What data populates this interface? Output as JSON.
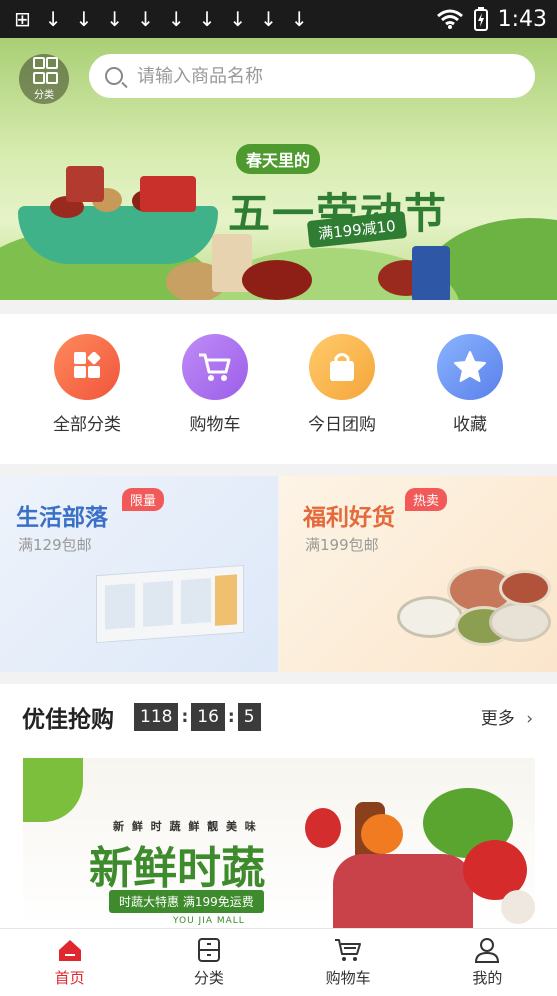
{
  "status_bar": {
    "time": "1:43"
  },
  "header": {
    "category_label": "分类",
    "search_placeholder": "请输入商品名称"
  },
  "banner": {
    "subtitle": "春天里的",
    "title": "五一劳动节",
    "promo": "满199减10"
  },
  "quick_nav": [
    {
      "label": "全部分类",
      "icon": "grid-icon",
      "color": "#f6664a"
    },
    {
      "label": "购物车",
      "icon": "cart-icon",
      "color": "#a56ef0"
    },
    {
      "label": "今日团购",
      "icon": "bag-icon",
      "color": "#f7b54a"
    },
    {
      "label": "收藏",
      "icon": "star-icon",
      "color": "#5f8ff0"
    }
  ],
  "promo_cards": [
    {
      "title": "生活部落",
      "badge": "限量",
      "subtitle": "满129包邮",
      "title_color": "#3a70c8"
    },
    {
      "title": "福利好货",
      "badge": "热卖",
      "subtitle": "满199包邮",
      "title_color": "#e4693b"
    }
  ],
  "flash_sale": {
    "title": "优佳抢购",
    "timer": {
      "hours": "118",
      "minutes": "16",
      "seconds": "5"
    },
    "more_label": "更多",
    "banner": {
      "tagline": "新 鲜 时 蔬 鲜 靓 美 味",
      "title": "新鲜时蔬",
      "promo": "时蔬大特惠 满199免运费",
      "brand": "YOU JIA MALL"
    }
  },
  "tab_bar": [
    {
      "label": "首页",
      "icon": "home-icon",
      "active": true
    },
    {
      "label": "分类",
      "icon": "category-icon",
      "active": false
    },
    {
      "label": "购物车",
      "icon": "cart-icon",
      "active": false
    },
    {
      "label": "我的",
      "icon": "user-icon",
      "active": false
    }
  ],
  "colors": {
    "accent": "#e0272e",
    "timer_bg": "#3b3b3b"
  }
}
